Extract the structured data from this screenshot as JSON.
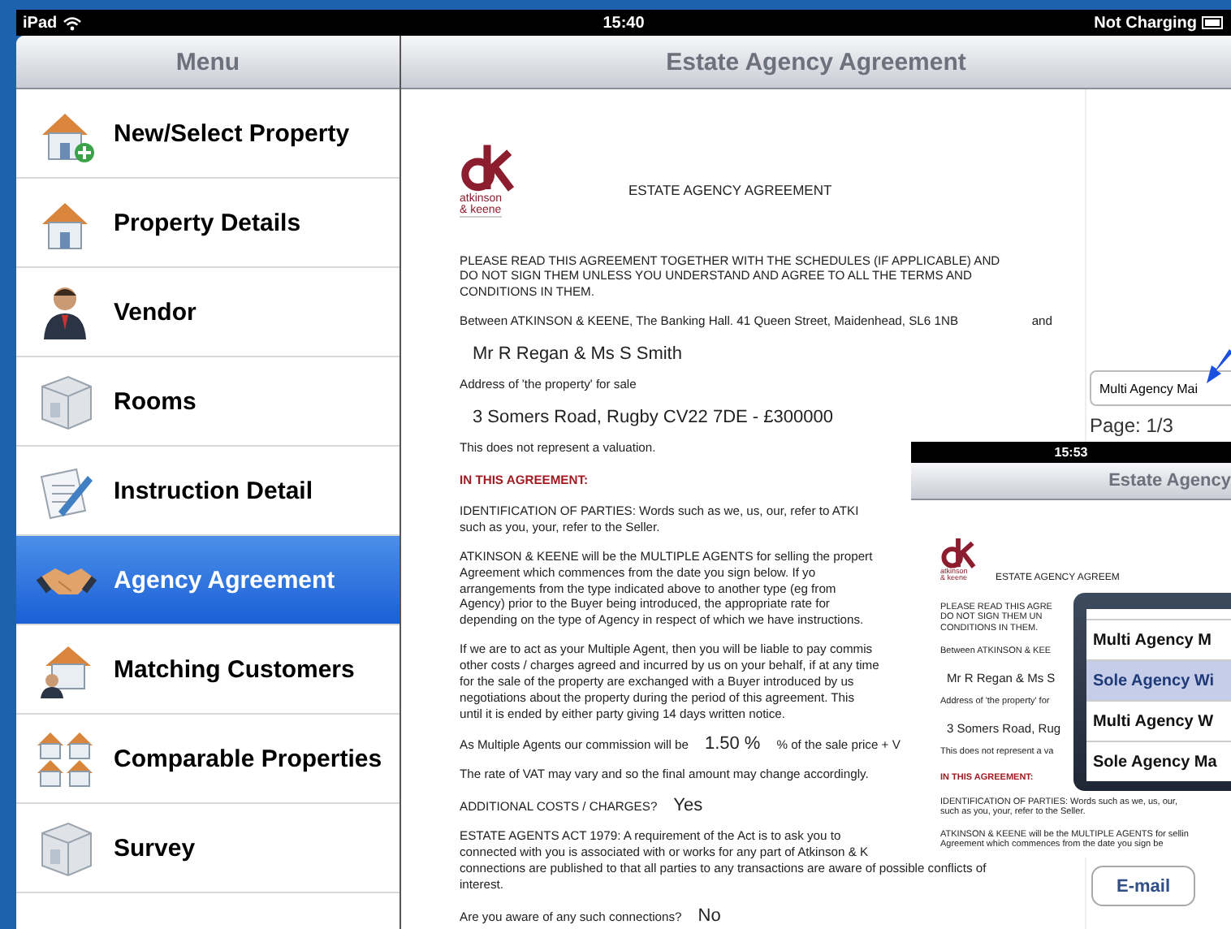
{
  "status_bar": {
    "device": "iPad",
    "time": "15:40",
    "battery": "Not Charging"
  },
  "sidebar": {
    "title": "Menu",
    "items": [
      {
        "label": "New/Select Property",
        "kind": "house-plus",
        "selected": false
      },
      {
        "label": "Property Details",
        "kind": "house",
        "selected": false
      },
      {
        "label": "Vendor",
        "kind": "person",
        "selected": false
      },
      {
        "label": "Rooms",
        "kind": "room",
        "selected": false
      },
      {
        "label": "Instruction Detail",
        "kind": "document",
        "selected": false
      },
      {
        "label": "Agency Agreement",
        "kind": "handshake",
        "selected": true
      },
      {
        "label": "Matching Customers",
        "kind": "house-person",
        "selected": false
      },
      {
        "label": "Comparable Properties",
        "kind": "houses",
        "selected": false
      },
      {
        "label": "Survey",
        "kind": "room",
        "selected": false
      }
    ]
  },
  "main": {
    "title": "Estate Agency Agreement",
    "document": {
      "logo_text": [
        "atkinson",
        "& keene"
      ],
      "title": "ESTATE AGENCY AGREEMENT",
      "blocks": [
        {
          "kind": "para",
          "lines": [
            "PLEASE READ THIS AGREEMENT TOGETHER WITH THE SCHEDULES (IF APPLICABLE) AND",
            "DO NOT SIGN THEM UNLESS YOU UNDERSTAND AND AGREE TO ALL THE TERMS AND",
            "CONDITIONS IN THEM."
          ]
        },
        {
          "kind": "between",
          "text": "Between ATKINSON & KEENE, The Banking Hall. 41 Queen Street, Maidenhead, SL6 1NB",
          "suffix": "and"
        },
        {
          "kind": "field",
          "text": "Mr R Regan & Ms S Smith"
        },
        {
          "kind": "small",
          "text": "Address of 'the property' for sale"
        },
        {
          "kind": "field",
          "text": "3 Somers Road, Rugby CV22 7DE - £300000"
        },
        {
          "kind": "small",
          "text": "This does not represent a valuation."
        },
        {
          "kind": "heading",
          "text": "IN THIS AGREEMENT:"
        },
        {
          "kind": "para",
          "lines": [
            "IDENTIFICATION OF PARTIES: Words such as we, us, our, refer to ATKI",
            "such as you, your, refer to the Seller."
          ]
        },
        {
          "kind": "para",
          "lines": [
            "ATKINSON & KEENE will be the MULTIPLE AGENTS for selling the propert",
            "Agreement which commences from the date you sign below.  If yo",
            "arrangements from the type indicated above to another type (eg from",
            "Agency) prior to the Buyer being introduced, the appropriate rate for",
            "depending on the type of Agency in respect of which we have instructions."
          ]
        },
        {
          "kind": "para",
          "lines": [
            "If we are to act as your Multiple Agent, then you will be liable to pay commis",
            "other costs / charges agreed and incurred by us on your behalf, if at any time",
            "for the sale of the property are exchanged with a Buyer introduced by us",
            "negotiations about the property during the period of this agreement. This",
            "until it is ended by either party giving 14 days written notice."
          ]
        },
        {
          "kind": "answer",
          "label": "As Multiple Agents our commission will be",
          "value": "1.50 %",
          "suffix": "% of the sale price + V"
        },
        {
          "kind": "para",
          "lines": [
            "The rate of VAT may vary and so the final amount may change accordingly."
          ]
        },
        {
          "kind": "answer",
          "label": "ADDITIONAL COSTS / CHARGES?",
          "value": "Yes"
        },
        {
          "kind": "para",
          "lines": [
            "ESTATE AGENTS ACT 1979:  A requirement of the Act is to ask you to",
            "connected with you is associated with or works for any part of Atkinson & K"
          ]
        },
        {
          "kind": "continued",
          "lines": [
            "connections are published to that all parties to any transactions are aware of possible conflicts of",
            "interest."
          ]
        },
        {
          "kind": "answer",
          "label": "Are you aware of any such connections?",
          "value": "No"
        }
      ]
    },
    "agency_field": {
      "value": "Multi Agency Mai"
    },
    "page": "Page: 1/3"
  },
  "inset": {
    "time": "15:53",
    "title": "Estate Agency",
    "doc_title": "ESTATE AGENCY AGREEM",
    "logo_text": [
      "atkinson",
      "& keene"
    ],
    "blocks": [
      {
        "kind": "para",
        "lines": [
          "PLEASE READ THIS AGRE",
          "DO NOT SIGN THEM UN",
          "CONDITIONS IN THEM."
        ]
      },
      {
        "kind": "small",
        "text": "Between ATKINSON & KEE"
      },
      {
        "kind": "field",
        "text": "Mr R Regan & Ms S"
      },
      {
        "kind": "small",
        "text": "Address of 'the property' for"
      },
      {
        "kind": "field",
        "text": "3 Somers Road, Rug"
      },
      {
        "kind": "small",
        "text": "This does not represent a va"
      },
      {
        "kind": "heading",
        "text": "IN THIS AGREEMENT:"
      },
      {
        "kind": "para",
        "lines": [
          "IDENTIFICATION OF PARTIES: Words such as we, us, our,",
          "such as you, your, refer to the Seller."
        ]
      },
      {
        "kind": "para",
        "lines": [
          "ATKINSON & KEENE will be the MULTIPLE AGENTS for sellin",
          "Agreement which commences from the date you sign be"
        ]
      }
    ],
    "picker": [
      {
        "label": "Multi Agency M",
        "selected": false
      },
      {
        "label": "Sole Agency Wi",
        "selected": true
      },
      {
        "label": "Multi Agency W",
        "selected": false
      },
      {
        "label": "Sole Agency Ma",
        "selected": false
      }
    ],
    "email_button": "E-mail"
  }
}
